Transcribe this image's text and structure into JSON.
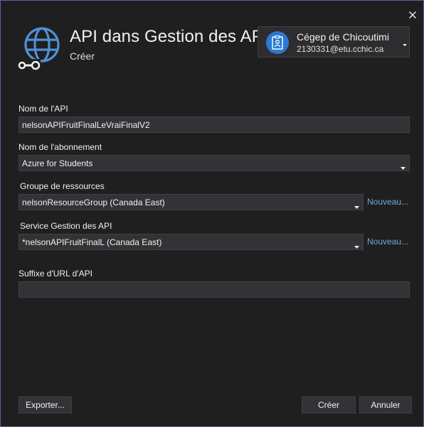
{
  "dialog": {
    "title": "API dans Gestion des API",
    "subtitle": "Créer",
    "close_icon": "close-icon",
    "header_icon": "api-globe-icon"
  },
  "account": {
    "name": "Cégep de Chicoutimi",
    "email": "2130331@etu.cchic.ca",
    "avatar_icon": "badge-icon",
    "avatar_color": "#2b79d3"
  },
  "form": {
    "api_name_label": "Nom de l'API",
    "api_name_value": "nelsonAPIFruitFinalLeVraiFinalV2",
    "subscription_label": "Nom de l'abonnement",
    "subscription_value": "Azure for Students",
    "resource_group_label": "Groupe de ressources",
    "resource_group_value": "nelsonResourceGroup (Canada East)",
    "resource_group_new": "Nouveau...",
    "apim_service_label": "Service Gestion des API",
    "apim_service_value": "*nelsonAPIFruitFinalL (Canada East)",
    "apim_service_new": "Nouveau...",
    "url_suffix_label": "Suffixe d'URL d'API",
    "url_suffix_value": ""
  },
  "footer": {
    "export_label": "Exporter...",
    "create_label": "Créer",
    "cancel_label": "Annuler"
  },
  "colors": {
    "background": "#1f1f1f",
    "field": "#333337",
    "link": "#6fa8dc",
    "border_accent": "#5a5fa8",
    "icon_blue": "#4f8fd8"
  }
}
